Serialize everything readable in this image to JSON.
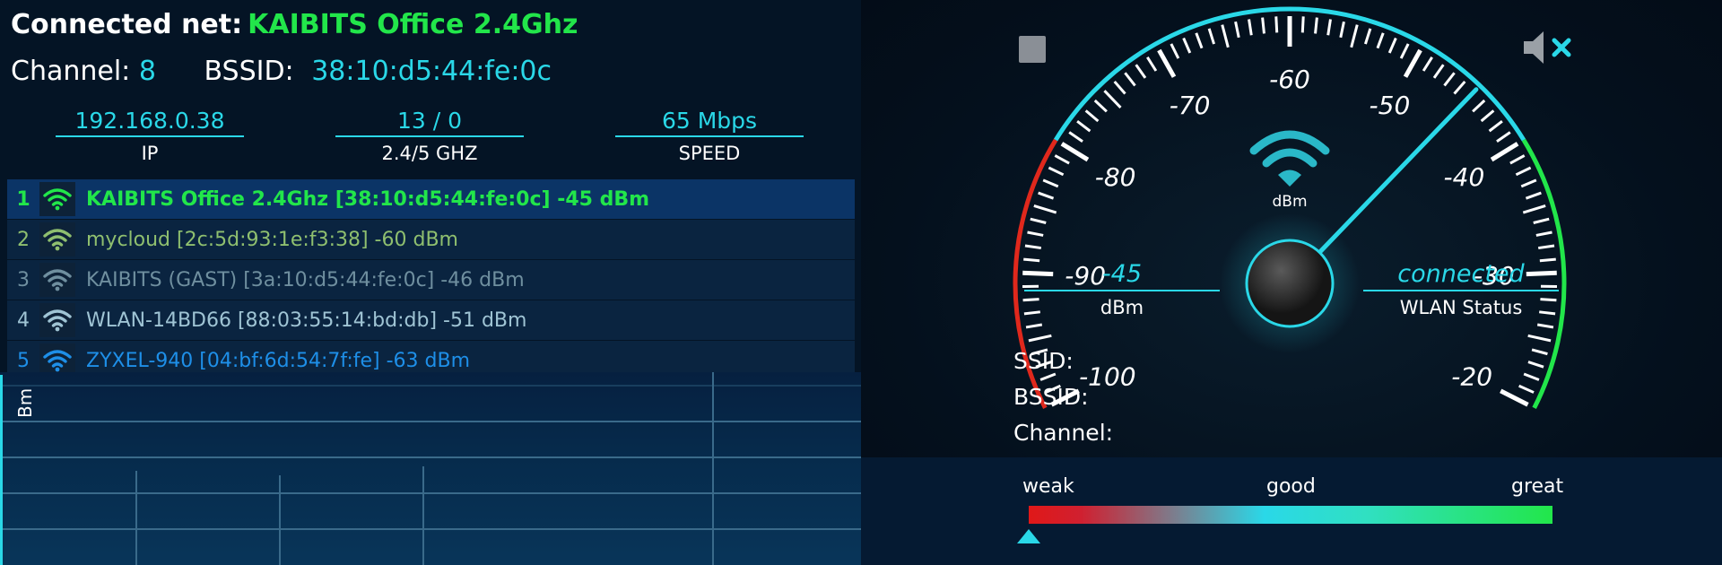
{
  "header": {
    "connected_label": "Connected net:",
    "connected_value": "KAIBITS Office 2.4Ghz",
    "channel_label": "Channel:",
    "channel_value": "8",
    "bssid_label": "BSSID:",
    "bssid_value": "38:10:d5:44:fe:0c"
  },
  "stats": [
    {
      "value": "192.168.0.38",
      "label": "IP"
    },
    {
      "value": "13 / 0",
      "label": "2.4/5 GHZ"
    },
    {
      "value": "65 Mbps",
      "label": "SPEED"
    }
  ],
  "networks": [
    {
      "num": "1",
      "text": "KAIBITS Office 2.4Ghz [38:10:d5:44:fe:0c] -45 dBm",
      "color": "#22e64a",
      "selected": true
    },
    {
      "num": "2",
      "text": "mycloud [2c:5d:93:1e:f3:38] -60 dBm",
      "color": "#8fbf6f",
      "selected": false
    },
    {
      "num": "3",
      "text": "KAIBITS (GAST) [3a:10:d5:44:fe:0c] -46 dBm",
      "color": "#6f8f9f",
      "selected": false
    },
    {
      "num": "4",
      "text": "WLAN-14BD66 [88:03:55:14:bd:db] -51 dBm",
      "color": "#9fc4d4",
      "selected": false
    },
    {
      "num": "5",
      "text": "ZYXEL-940 [04:bf:6d:54:7f:fe] -63 dBm",
      "color": "#1e8fe8",
      "selected": false
    }
  ],
  "graph": {
    "axis_label": "Bm"
  },
  "gauge": {
    "min": -100,
    "max": -20,
    "value": -45,
    "tick_labels": [
      "-100",
      "-90",
      "-80",
      "-70",
      "-60",
      "-50",
      "-40",
      "-30",
      "-20"
    ],
    "unit_label": "dBm",
    "icon": "wifi-icon"
  },
  "readouts": {
    "dbm_value": "-45",
    "dbm_label": "dBm",
    "status_value": "connected",
    "status_label": "WLAN Status"
  },
  "info": {
    "ssid_label": "SSID:",
    "bssid_label": "BSSID:",
    "channel_label": "Channel:"
  },
  "meter": {
    "weak": "weak",
    "good": "good",
    "great": "great",
    "level": 0
  },
  "icons": {
    "stop": "stop-icon",
    "mute": "mute-icon"
  },
  "colors": {
    "accent": "#2ad8e8",
    "green": "#22e64a",
    "red": "#e01818"
  }
}
